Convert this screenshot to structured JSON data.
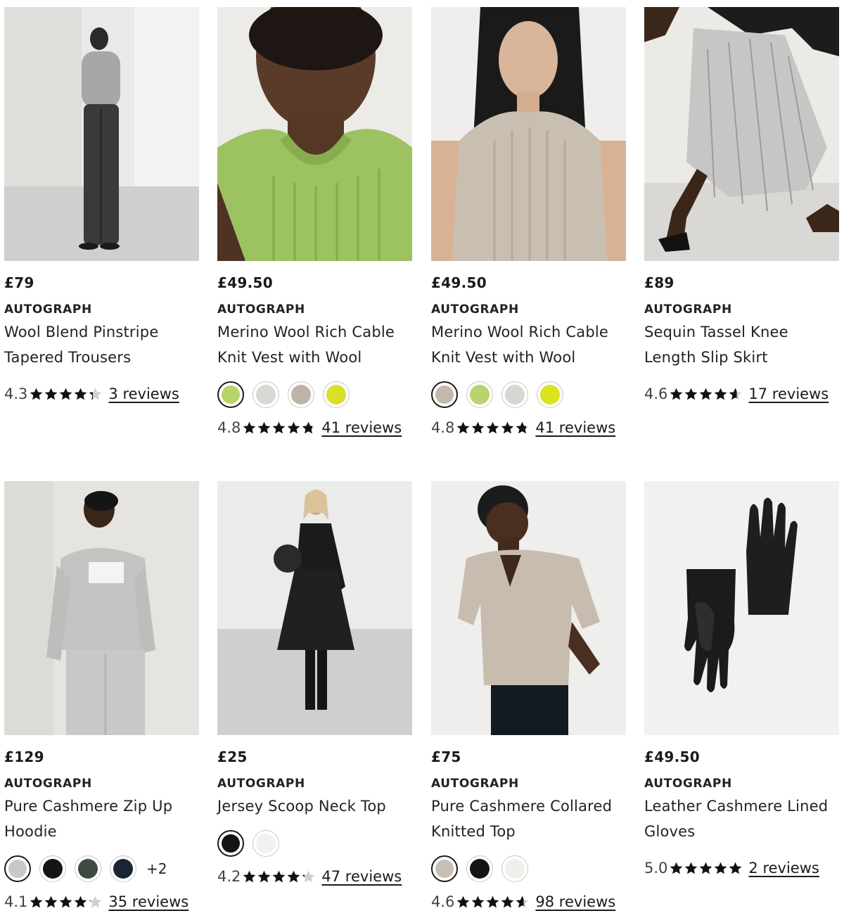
{
  "products": [
    {
      "price": "£79",
      "brand": "AUTOGRAPH",
      "name_line1": "Wool Blend Pinstripe",
      "name_line2": "Tapered Trousers",
      "rating": "4.3",
      "rating_value": 4.3,
      "reviews": "3 reviews",
      "swatches": [],
      "more": ""
    },
    {
      "price": "£49.50",
      "brand": "AUTOGRAPH",
      "name_line1": "Merino Wool Rich Cable",
      "name_line2": "Knit Vest with Wool",
      "rating": "4.8",
      "rating_value": 4.8,
      "reviews": "41 reviews",
      "swatches": [
        "#b8d36a",
        "#d9d9d4",
        "#bdb3a6",
        "#d9e02a"
      ],
      "selected_swatch": 0,
      "more": ""
    },
    {
      "price": "£49.50",
      "brand": "AUTOGRAPH",
      "name_line1": "Merino Wool Rich Cable",
      "name_line2": "Knit Vest with Wool",
      "rating": "4.8",
      "rating_value": 4.8,
      "reviews": "41 reviews",
      "swatches": [
        "#c3b9ab",
        "#b9d36e",
        "#d5d7d3",
        "#dae31e"
      ],
      "selected_swatch": 0,
      "more": ""
    },
    {
      "price": "£89",
      "brand": "AUTOGRAPH",
      "name_line1": "Sequin Tassel Knee",
      "name_line2": "Length Slip Skirt",
      "rating": "4.6",
      "rating_value": 4.6,
      "reviews": "17 reviews",
      "swatches": [],
      "more": ""
    },
    {
      "price": "£129",
      "brand": "AUTOGRAPH",
      "name_line1": "Pure Cashmere Zip Up",
      "name_line2": "Hoodie",
      "rating": "4.1",
      "rating_value": 4.1,
      "reviews": "35 reviews",
      "swatches": [
        "#c8c8c6",
        "#151515",
        "#3d4a3e",
        "#1b2435"
      ],
      "selected_swatch": 0,
      "more": "+2"
    },
    {
      "price": "£25",
      "brand": "AUTOGRAPH",
      "name_line1": "Jersey Scoop Neck Top",
      "name_line2": "",
      "rating": "4.2",
      "rating_value": 4.2,
      "reviews": "47 reviews",
      "swatches": [
        "#141414",
        "#f1f1f1"
      ],
      "selected_swatch": 0,
      "more": ""
    },
    {
      "price": "£75",
      "brand": "AUTOGRAPH",
      "name_line1": "Pure Cashmere Collared",
      "name_line2": "Knitted Top",
      "rating": "4.6",
      "rating_value": 4.6,
      "reviews": "98 reviews",
      "swatches": [
        "#c7bfb3",
        "#141414",
        "#efefec"
      ],
      "selected_swatch": 0,
      "more": ""
    },
    {
      "price": "£49.50",
      "brand": "AUTOGRAPH",
      "name_line1": "Leather Cashmere Lined",
      "name_line2": "Gloves",
      "rating": "5.0",
      "rating_value": 5.0,
      "reviews": "2 reviews",
      "swatches": [],
      "more": ""
    }
  ]
}
